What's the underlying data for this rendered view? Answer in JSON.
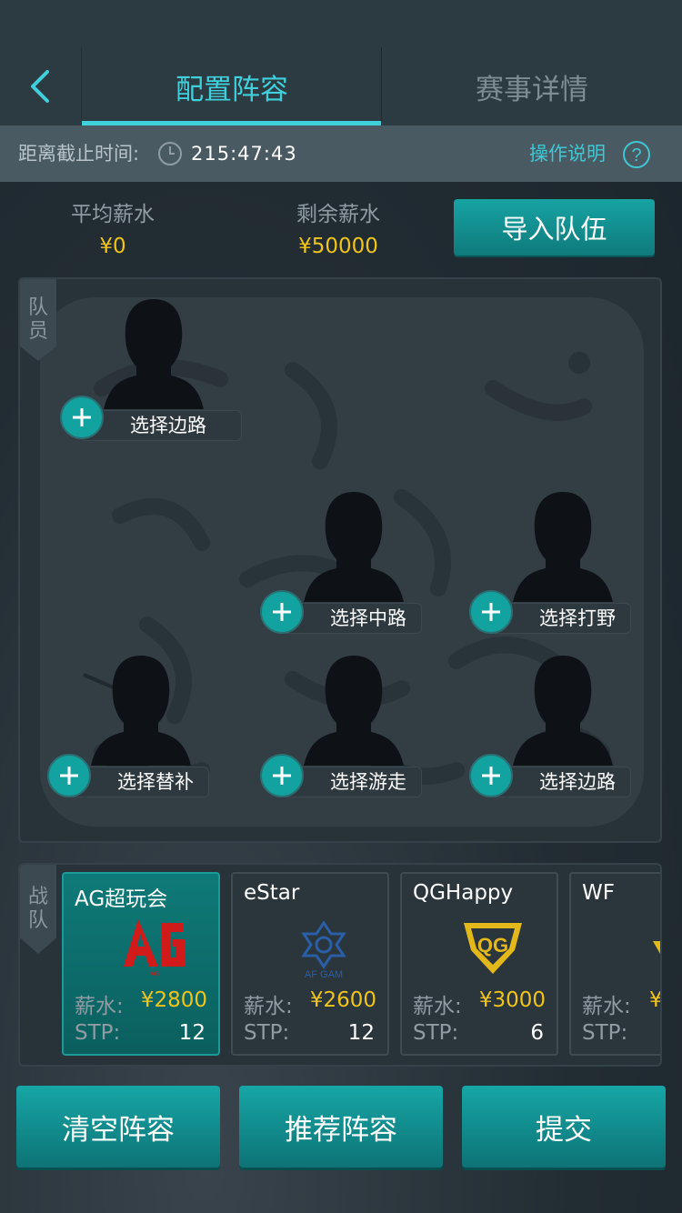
{
  "header": {
    "tabs": [
      {
        "label": "配置阵容",
        "active": true
      },
      {
        "label": "赛事详情",
        "active": false
      }
    ]
  },
  "deadline": {
    "label": "距离截止时间:",
    "time": "215:47:43",
    "help_label": "操作说明"
  },
  "salary": {
    "average_label": "平均薪水",
    "average_value": "¥0",
    "remaining_label": "剩余薪水",
    "remaining_value": "¥50000",
    "import_button": "导入队伍"
  },
  "players_panel": {
    "tag": [
      "队",
      "员"
    ],
    "slots": [
      {
        "label": "选择边路"
      },
      {
        "label": "选择中路"
      },
      {
        "label": "选择打野"
      },
      {
        "label": "选择替补"
      },
      {
        "label": "选择游走"
      },
      {
        "label": "选择边路"
      }
    ]
  },
  "teams_panel": {
    "tag": [
      "战",
      "队"
    ],
    "salary_label": "薪水:",
    "stp_label": "STP:",
    "teams": [
      {
        "name": "AG超玩会",
        "salary": "¥2800",
        "stp": "12",
        "selected": true,
        "logo": "ag-logo"
      },
      {
        "name": "eStar",
        "salary": "¥2600",
        "stp": "12",
        "selected": false,
        "logo": "estar-logo"
      },
      {
        "name": "QGHappy",
        "salary": "¥3000",
        "stp": "6",
        "selected": false,
        "logo": "qg-logo"
      },
      {
        "name": "WF",
        "salary": "¥",
        "stp": "",
        "selected": false,
        "logo": "wf-logo"
      }
    ],
    "logo_texts": {
      "ag": "AG",
      "estar": "AF GAM",
      "qg": "QG"
    }
  },
  "bottom": {
    "clear_button": "清空阵容",
    "recommend_button": "推荐阵容",
    "submit_button": "提交"
  },
  "colors": {
    "accent": "#3fd0dc",
    "button": "#13999a",
    "gold": "#f0c419",
    "panel": "#283239"
  }
}
